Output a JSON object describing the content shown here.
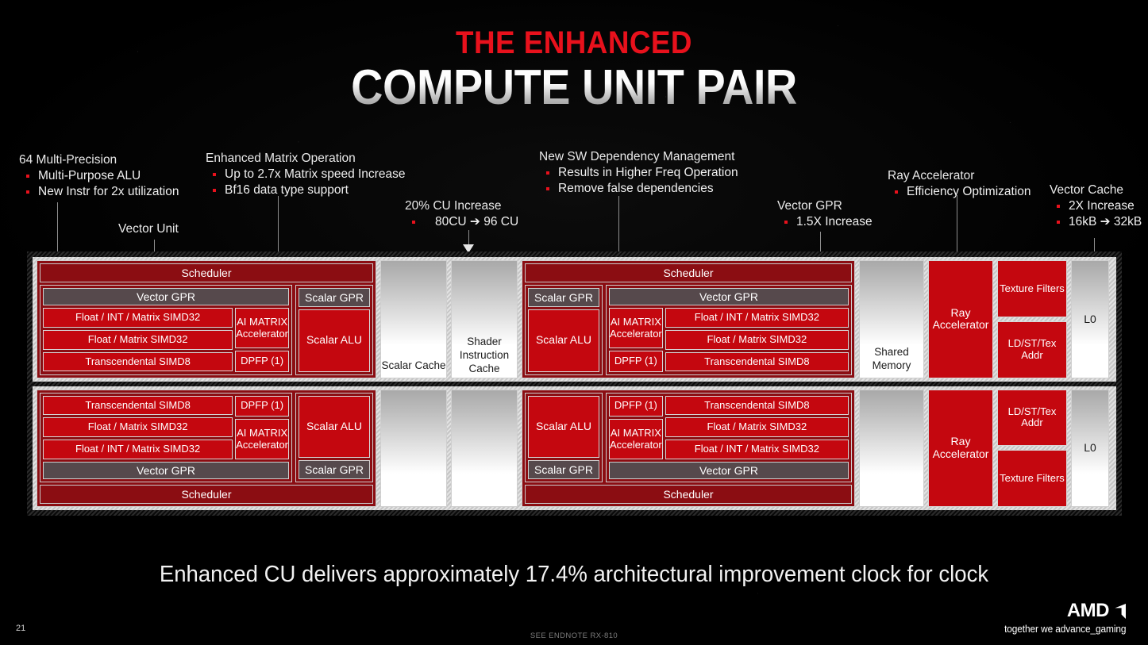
{
  "title": {
    "line1": "THE ENHANCED",
    "line2": "COMPUTE UNIT PAIR"
  },
  "colors": {
    "accent_red": "#E8111C",
    "block_red": "#C4070F",
    "scheduler_red": "#8B0D12",
    "gpr_gray": "#56494C",
    "background": "#000000"
  },
  "callouts": [
    {
      "id": "multi-precision",
      "head": "64 Multi-Precision",
      "bullets": [
        "Multi-Purpose ALU",
        "New Instr for 2x utilization"
      ]
    },
    {
      "id": "matrix-operation",
      "head": "Enhanced Matrix Operation",
      "bullets": [
        "Up to 2.7x Matrix speed Increase",
        "Bf16 data type support"
      ]
    },
    {
      "id": "cu-increase",
      "head": "20% CU Increase",
      "bullets": [
        "80CU ➔ 96 CU"
      ]
    },
    {
      "id": "sw-dependency",
      "head": "New SW Dependency Management",
      "bullets": [
        "Results in Higher Freq Operation",
        "Remove false dependencies"
      ]
    },
    {
      "id": "vector-gpr",
      "head": "Vector GPR",
      "bullets": [
        "1.5X Increase"
      ]
    },
    {
      "id": "ray-accelerator",
      "head": "Ray Accelerator",
      "bullets": [
        "Efficiency Optimization"
      ]
    },
    {
      "id": "vector-cache",
      "head": "Vector Cache",
      "bullets": [
        "2X Increase",
        "16kB ➔ 32kB"
      ]
    }
  ],
  "label_vector_unit": "Vector Unit",
  "diagram": {
    "scheduler": "Scheduler",
    "vector_gpr": "Vector GPR",
    "scalar_gpr": "Scalar GPR",
    "scalar_alu": "Scalar ALU",
    "ai_matrix": "AI MATRIX Accelerator",
    "dpfp": "DPFP (1)",
    "simd_float_int": "Float / INT / Matrix SIMD32",
    "simd_float": "Float / Matrix SIMD32",
    "simd_transcendental": "Transcendental SIMD8",
    "scalar_cache": "Scalar Cache",
    "shader_instruction_cache": "Shader Instruction Cache",
    "shared_memory": "Shared Memory",
    "ray_accelerator": "Ray Accelerator",
    "texture_filters": "Texture Filters",
    "ldst_tex_addr": "LD/ST/Tex Addr",
    "l0": "L0"
  },
  "footer": {
    "tagline": "Enhanced CU delivers approximately 17.4% architectural improvement clock for clock",
    "page_number": "21",
    "endnote": "SEE ENDNOTE RX-810",
    "amd_word": "AMD",
    "amd_tagline": "together we advance_gaming"
  }
}
